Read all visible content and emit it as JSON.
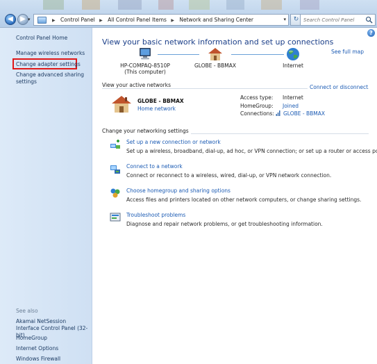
{
  "address_bar": {
    "breadcrumbs": [
      "Control Panel",
      "All Control Panel Items",
      "Network and Sharing Center"
    ],
    "search_placeholder": "Search Control Panel"
  },
  "left_pane": {
    "home": "Control Panel Home",
    "links": [
      "Manage wireless networks",
      "Change adapter settings",
      "Change advanced sharing settings"
    ],
    "see_also_label": "See also",
    "see_also": [
      "Akamai NetSession Interface Control Panel (32-bit)",
      "HomeGroup",
      "Internet Options",
      "Windows Firewall"
    ]
  },
  "main": {
    "heading": "View your basic network information and set up connections",
    "see_full_map": "See full map",
    "map": {
      "computer": "HP-COMPAQ-8510P",
      "computer_sub": "(This computer)",
      "network": "GLOBE - BBMAX",
      "internet": "Internet"
    },
    "active_label": "View your active networks",
    "connect_disconnect": "Connect or disconnect",
    "active_network": {
      "name": "GLOBE - BBMAX",
      "type": "Home network",
      "access_type_label": "Access type:",
      "access_type_value": "Internet",
      "homegroup_label": "HomeGroup:",
      "homegroup_value": "Joined",
      "connections_label": "Connections:",
      "connections_value": "GLOBE - BBMAX"
    },
    "change_label": "Change your networking settings",
    "tasks": [
      {
        "title": "Set up a new connection or network",
        "desc": "Set up a wireless, broadband, dial-up, ad hoc, or VPN connection; or set up a router or access point."
      },
      {
        "title": "Connect to a network",
        "desc": "Connect or reconnect to a wireless, wired, dial-up, or VPN network connection."
      },
      {
        "title": "Choose homegroup and sharing options",
        "desc": "Access files and printers located on other network computers, or change sharing settings."
      },
      {
        "title": "Troubleshoot problems",
        "desc": "Diagnose and repair network problems, or get troubleshooting information."
      }
    ]
  }
}
